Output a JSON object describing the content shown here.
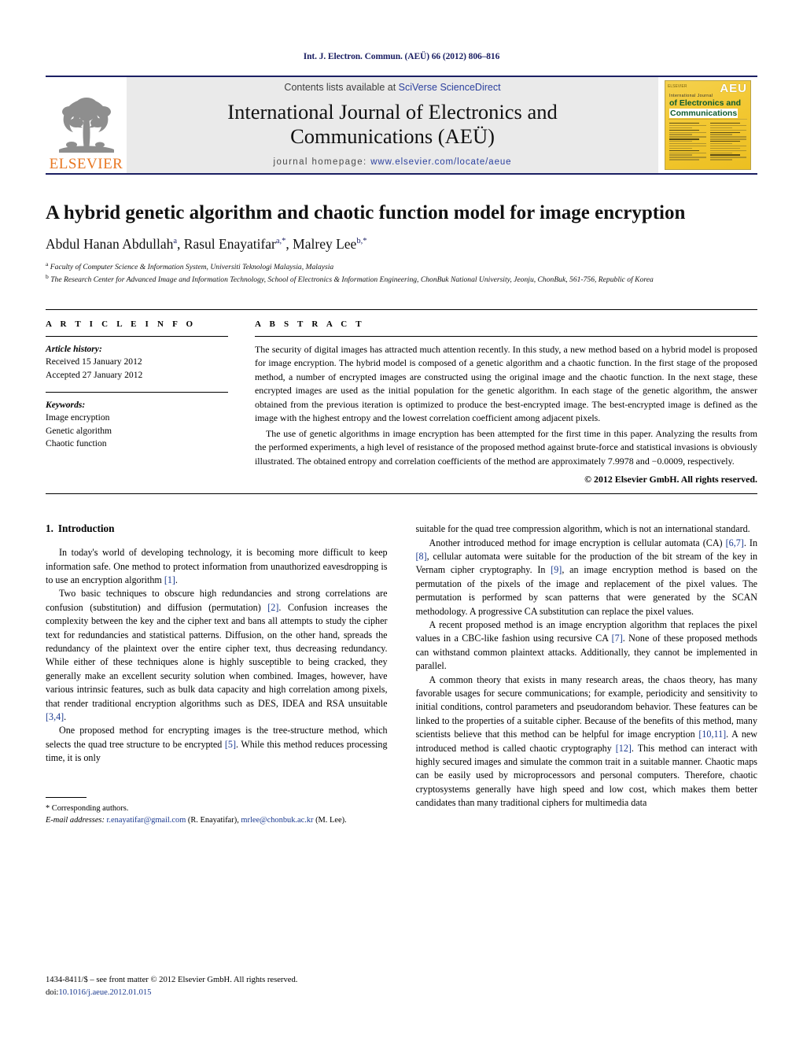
{
  "running_head": "Int. J. Electron. Commun. (AEÜ) 66 (2012) 806–816",
  "masthead": {
    "publisher_name": "ELSEVIER",
    "contents_prefix": "Contents lists available at ",
    "sciencedirect": "SciVerse ScienceDirect",
    "journal_title_line1": "International Journal of Electronics and",
    "journal_title_line2": "Communications (AEÜ)",
    "homepage_prefix": "journal homepage: ",
    "homepage_url": "www.elsevier.com/locate/aeue",
    "cover": {
      "badge": "AEU",
      "line_small": "International Journal",
      "line_of": "of Electronics and",
      "line_comm": "Communications",
      "els_mark": "ELSEVIER"
    }
  },
  "article": {
    "title": "A hybrid genetic algorithm and chaotic function model for image encryption",
    "authors_plain": "Abdul Hanan Abdullah",
    "authors": [
      {
        "name": "Abdul Hanan Abdullah",
        "marks": "a"
      },
      {
        "name": "Rasul Enayatifar",
        "marks": "a,*"
      },
      {
        "name": "Malrey Lee",
        "marks": "b,*"
      }
    ],
    "affiliation_a": "Faculty of Computer Science & Information System, Universiti Teknologi Malaysia, Malaysia",
    "affiliation_b": "The Research Center for Advanced Image and Information Technology, School of Electronics & Information Engineering, ChonBuk National University, Jeonju, ChonBuk, 561-756, Republic of Korea"
  },
  "article_info": {
    "heading": "A R T I C L E   I N F O",
    "history_label": "Article history:",
    "received": "Received 15 January 2012",
    "accepted": "Accepted 27 January 2012",
    "keywords_label": "Keywords:",
    "keywords": [
      "Image encryption",
      "Genetic algorithm",
      "Chaotic function"
    ]
  },
  "abstract": {
    "heading": "A B S T R A C T",
    "paragraph1": "The security of digital images has attracted much attention recently. In this study, a new method based on a hybrid model is proposed for image encryption. The hybrid model is composed of a genetic algorithm and a chaotic function. In the first stage of the proposed method, a number of encrypted images are constructed using the original image and the chaotic function. In the next stage, these encrypted images are used as the initial population for the genetic algorithm. In each stage of the genetic algorithm, the answer obtained from the previous iteration is optimized to produce the best-encrypted image. The best-encrypted image is defined as the image with the highest entropy and the lowest correlation coefficient among adjacent pixels.",
    "paragraph2": "The use of genetic algorithms in image encryption has been attempted for the first time in this paper. Analyzing the results from the performed experiments, a high level of resistance of the proposed method against brute-force and statistical invasions is obviously illustrated. The obtained entropy and correlation coefficients of the method are approximately 7.9978 and −0.0009, respectively.",
    "copyright": "© 2012 Elsevier GmbH. All rights reserved."
  },
  "introduction": {
    "number": "1.",
    "heading": "Introduction",
    "left_p1_a": "In today's world of developing technology, it is becoming more difficult to keep information safe. One method to protect information from unauthorized eavesdropping is to use an encryption algorithm ",
    "left_p1_ref": "[1]",
    "left_p1_b": ".",
    "left_p2_a": "Two basic techniques to obscure high redundancies and strong correlations are confusion (substitution) and diffusion (permutation) ",
    "left_p2_ref1": "[2]",
    "left_p2_b": ". Confusion increases the complexity between the key and the cipher text and bans all attempts to study the cipher text for redundancies and statistical patterns. Diffusion, on the other hand, spreads the redundancy of the plaintext over the entire cipher text, thus decreasing redundancy. While either of these techniques alone is highly susceptible to being cracked, they generally make an excellent security solution when combined. Images, however, have various intrinsic features, such as bulk data capacity and high correlation among pixels, that render traditional encryption algorithms such as DES, IDEA and RSA unsuitable ",
    "left_p2_ref2": "[3,4]",
    "left_p2_c": ".",
    "left_p3_a": "One proposed method for encrypting images is the tree-structure method, which selects the quad tree structure to be encrypted ",
    "left_p3_ref": "[5]",
    "left_p3_b": ". While this method reduces processing time, it is only",
    "right_p0": "suitable for the quad tree compression algorithm, which is not an international standard.",
    "right_p1_a": "Another introduced method for image encryption is cellular automata (CA) ",
    "right_p1_ref1": "[6,7]",
    "right_p1_b": ". In ",
    "right_p1_ref2": "[8]",
    "right_p1_c": ", cellular automata were suitable for the production of the bit stream of the key in Vernam cipher cryptography. In ",
    "right_p1_ref3": "[9]",
    "right_p1_d": ", an image encryption method is based on the permutation of the pixels of the image and replacement of the pixel values. The permutation is performed by scan patterns that were generated by the SCAN methodology. A progressive CA substitution can replace the pixel values.",
    "right_p2_a": "A recent proposed method is an image encryption algorithm that replaces the pixel values in a CBC-like fashion using recursive CA ",
    "right_p2_ref": "[7]",
    "right_p2_b": ". None of these proposed methods can withstand common plaintext attacks. Additionally, they cannot be implemented in parallel.",
    "right_p3_a": "A common theory that exists in many research areas, the chaos theory, has many favorable usages for secure communications; for example, periodicity and sensitivity to initial conditions, control parameters and pseudorandom behavior. These features can be linked to the properties of a suitable cipher. Because of the benefits of this method, many scientists believe that this method can be helpful for image encryption ",
    "right_p3_ref1": "[10,11]",
    "right_p3_b": ". A new introduced method is called chaotic cryptography ",
    "right_p3_ref2": "[12]",
    "right_p3_c": ". This method can interact with highly secured images and simulate the common trait in a suitable manner. Chaotic maps can be easily used by microprocessors and personal computers. Therefore, chaotic cryptosystems generally have high speed and low cost, which makes them better candidates than many traditional ciphers for multimedia data"
  },
  "footnote": {
    "corresponding": "* Corresponding authors.",
    "email_label": "E-mail addresses:",
    "email1": "r.enayatifar@gmail.com",
    "email1_owner": " (R. Enayatifar), ",
    "email2": "mrlee@chonbuk.ac.kr",
    "email2_owner": " (M. Lee)."
  },
  "page_footer": {
    "issn_line": "1434-8411/$ – see front matter © 2012 Elsevier GmbH. All rights reserved.",
    "doi_label": "doi:",
    "doi_value": "10.1016/j.aeue.2012.01.015"
  },
  "colors": {
    "navy": "#1b1f63",
    "link_blue": "#2b3f9e",
    "ref_blue": "#1b3a8f",
    "elsevier_orange": "#e87722",
    "band_gray": "#eaeaea"
  }
}
